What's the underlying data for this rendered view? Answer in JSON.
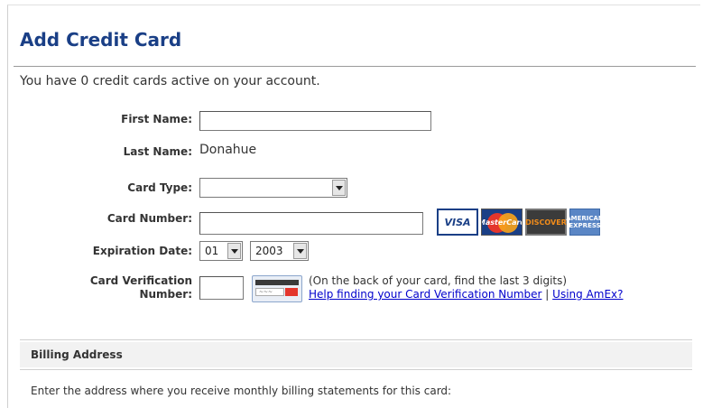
{
  "page": {
    "title": "Add Credit Card",
    "intro": "You have 0 credit cards active on your account."
  },
  "form": {
    "first_name": {
      "label": "First Name:",
      "value": ""
    },
    "last_name": {
      "label": "Last Name:",
      "value": "Donahue"
    },
    "card_type": {
      "label": "Card Type:",
      "value": ""
    },
    "card_number": {
      "label": "Card Number:",
      "value": ""
    },
    "expiration": {
      "label": "Expiration Date:",
      "month": "01",
      "year": "2003"
    },
    "cvv": {
      "label_line1": "Card Verification",
      "label_line2": "Number:",
      "value": "",
      "hint": "(On the back of your card, find the last 3 digits)",
      "help_link": "Help finding your Card Verification Number",
      "separator": "|",
      "amex_link": "Using AmEx?"
    }
  },
  "card_logos": [
    {
      "name": "visa-logo",
      "text": "VISA"
    },
    {
      "name": "mastercard-logo",
      "text": "MasterCard"
    },
    {
      "name": "discover-logo",
      "text": "DISCOVER"
    },
    {
      "name": "amex-logo",
      "text": "AMERICAN EXPRESS"
    }
  ],
  "billing": {
    "header": "Billing Address",
    "note": "Enter the address where you receive monthly billing statements for this card:"
  },
  "colors": {
    "title": "#1a3f86",
    "link": "#0000cc",
    "section_bg": "#f2f2f2"
  }
}
